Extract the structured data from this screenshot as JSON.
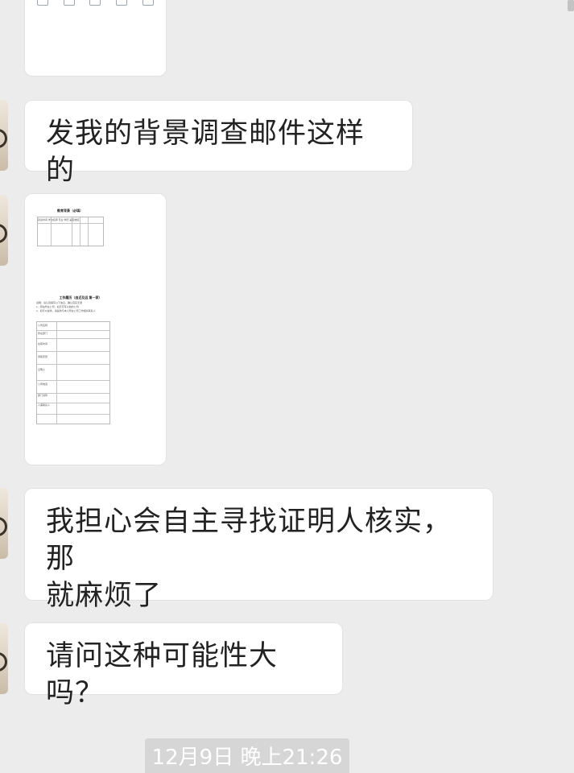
{
  "messages": [
    {
      "type": "image",
      "description_label": ""
    },
    {
      "type": "text",
      "text": "发我的背景调查邮件这样的"
    },
    {
      "type": "document-image"
    },
    {
      "type": "text",
      "text": "我担心会自主寻找证明人核实，那\n就麻烦了"
    },
    {
      "type": "text",
      "text": "请问这种可能性大吗？"
    }
  ],
  "doc_preview": {
    "title1": "教育背景（必填）",
    "header_row": "就读时间  学校名称  专业  学历  是否统招",
    "title2": "工作履历（由近及远 第一家）",
    "intro1": "说明：请认真填写以下信息，确认真实无误",
    "intro2": "1、现在所在公司，如无可写以前的公司",
    "intro3": "2、如可以提供，请提供与本人所在公司工作相关联系人",
    "fields": [
      "公司名称",
      "所在部门",
      "在职时间",
      "离职原因",
      "证明人",
      "公司电话",
      "部门领导",
      "人事联系人"
    ]
  },
  "timestamp": "12月9日 晚上21:26"
}
